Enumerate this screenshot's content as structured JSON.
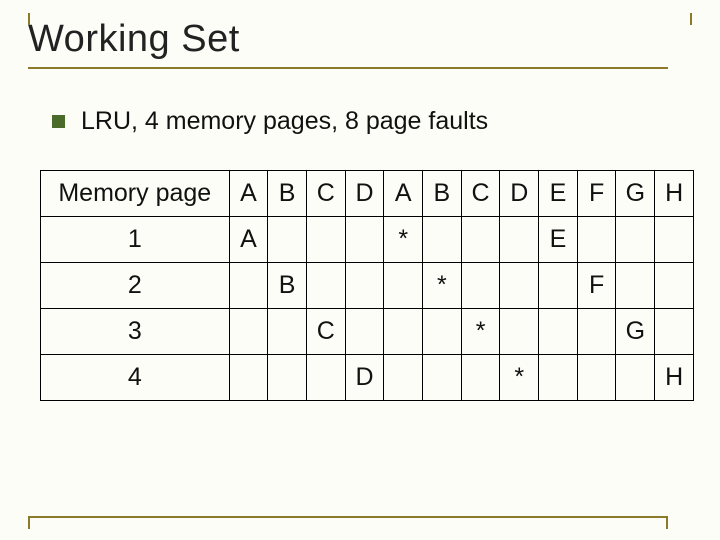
{
  "title": "Working Set",
  "subtitle": "LRU, 4 memory pages, 8 page faults",
  "table": {
    "header_label": "Memory page",
    "columns": [
      "A",
      "B",
      "C",
      "D",
      "A",
      "B",
      "C",
      "D",
      "E",
      "F",
      "G",
      "H"
    ],
    "rows": [
      {
        "label": "1",
        "cells": [
          "A",
          "",
          "",
          "",
          "*",
          "",
          "",
          "",
          "E",
          "",
          "",
          ""
        ]
      },
      {
        "label": "2",
        "cells": [
          "",
          "B",
          "",
          "",
          "",
          "*",
          "",
          "",
          "",
          "F",
          "",
          ""
        ]
      },
      {
        "label": "3",
        "cells": [
          "",
          "",
          "C",
          "",
          "",
          "",
          "*",
          "",
          "",
          "",
          "G",
          ""
        ]
      },
      {
        "label": "4",
        "cells": [
          "",
          "",
          "",
          "D",
          "",
          "",
          "",
          "*",
          "",
          "",
          "",
          "H"
        ]
      }
    ]
  }
}
